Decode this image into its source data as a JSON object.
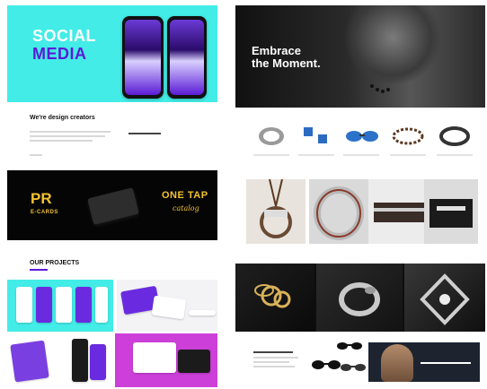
{
  "left": {
    "social": {
      "line1": "SOCIAL",
      "line2": "MEDIA"
    },
    "design": {
      "title": "We're design creators"
    },
    "pr": {
      "logo": "PR",
      "sub": "E-CARDS",
      "brand": "ONE TAP",
      "brand_sub": "catalog"
    },
    "projects": {
      "title": "OUR PROJECTS"
    }
  },
  "right": {
    "hero": {
      "line1": "Embrace",
      "line2": "the Moment."
    }
  },
  "colors": {
    "cyan": "#43ece7",
    "purple": "#5b1bd6",
    "gold": "#f2c230",
    "magenta": "#cc3fd8",
    "black": "#050505"
  }
}
